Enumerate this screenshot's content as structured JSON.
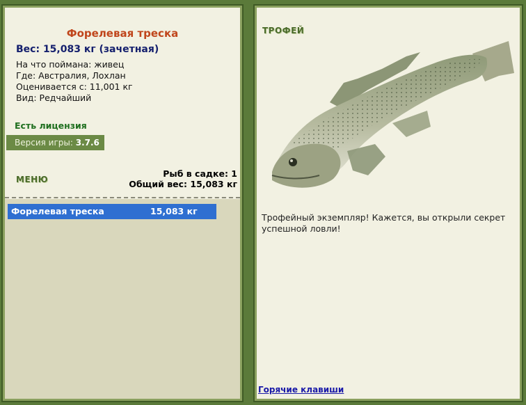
{
  "fish": {
    "name": "Форелевая треска",
    "weight_line": "Вес: 15,083 кг (зачетная)",
    "bait": "На что поймана: живец",
    "location": "Где: Австралия, Лохлан",
    "valued_from": "Оценивается с: 11,001 кг",
    "kind": "Вид: Редчайший"
  },
  "license": "Есть лицензия",
  "version": {
    "label": "Версия игры:",
    "value": "3.7.6"
  },
  "menu_label": "МЕНЮ",
  "keep": {
    "count": "Рыб в садке: 1",
    "total": "Общий вес: 15,083 кг"
  },
  "list": [
    {
      "name": "Форелевая треска",
      "weight": "15,083 кг"
    }
  ],
  "trophy": {
    "heading": "ТРОФЕЙ",
    "text": "Трофейный экземпляр! Кажется, вы открыли секрет успешной ловли!"
  },
  "hotkeys": "Горячие клавиши",
  "colors": {
    "background": "#5b7a3a",
    "panel": "#f2f1e2",
    "title": "#c0461c",
    "weight": "#15206e",
    "license": "#1f6f1f",
    "selected_row": "#2f6fd1",
    "link": "#1a1aa8"
  }
}
